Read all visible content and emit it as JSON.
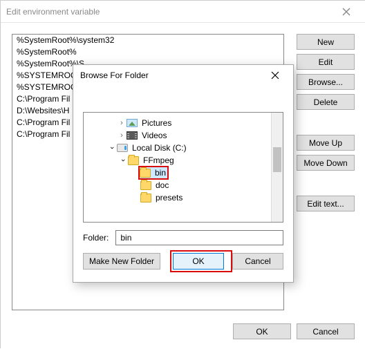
{
  "parent": {
    "title": "Edit environment variable",
    "list": [
      "%SystemRoot%\\system32",
      "%SystemRoot%",
      "%SystemRoot%\\S",
      "%SYSTEMROOT",
      "%SYSTEMROOT",
      "C:\\Program Fil",
      "D:\\Websites\\H",
      "C:\\Program Fil",
      "C:\\Program Fil"
    ],
    "buttons": {
      "new": "New",
      "edit": "Edit",
      "browse": "Browse...",
      "delete": "Delete",
      "move_up": "Move Up",
      "move_down": "Move Down",
      "edit_text": "Edit text..."
    },
    "footer": {
      "ok": "OK",
      "cancel": "Cancel"
    }
  },
  "browse": {
    "title": "Browse For Folder",
    "tree": {
      "pictures": "Pictures",
      "videos": "Videos",
      "disk": "Local Disk (C:)",
      "ffmpeg": "FFmpeg",
      "bin": "bin",
      "doc": "doc",
      "presets": "presets"
    },
    "folder_label": "Folder:",
    "folder_value": "bin",
    "buttons": {
      "make_new": "Make New Folder",
      "ok": "OK",
      "cancel": "Cancel"
    }
  }
}
